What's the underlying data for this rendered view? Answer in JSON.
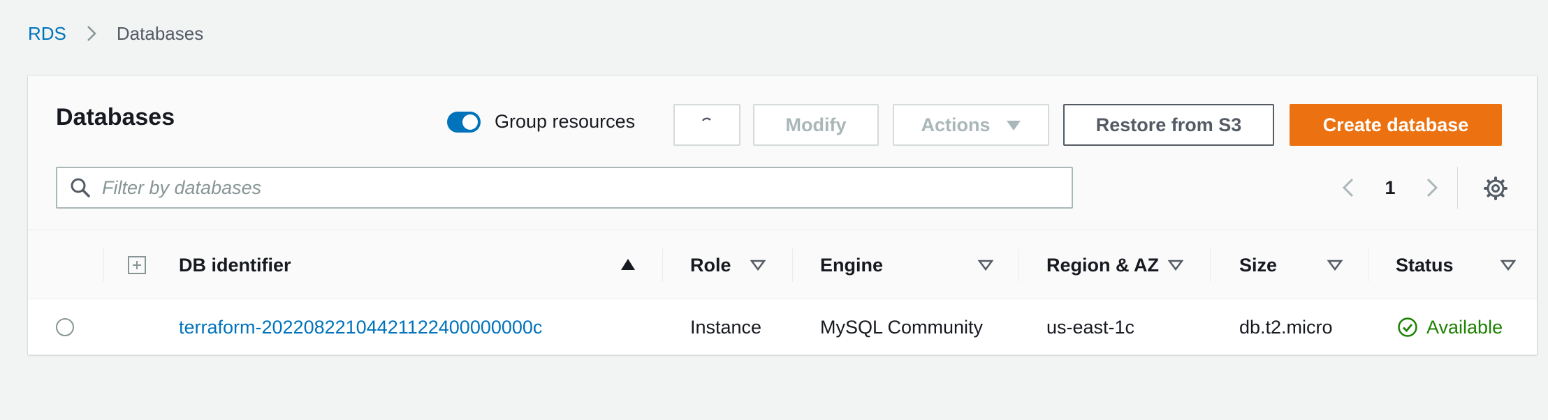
{
  "breadcrumb": {
    "root": "RDS",
    "current": "Databases"
  },
  "panel": {
    "title": "Databases",
    "group_resources_label": "Group resources",
    "group_resources_on": true
  },
  "toolbar": {
    "modify_label": "Modify",
    "actions_label": "Actions",
    "restore_label": "Restore from S3",
    "create_label": "Create database"
  },
  "search": {
    "placeholder": "Filter by databases",
    "value": ""
  },
  "pagination": {
    "current_page": "1"
  },
  "table": {
    "columns": [
      {
        "label": "DB identifier",
        "sort": "ascending"
      },
      {
        "label": "Role",
        "sort": "none"
      },
      {
        "label": "Engine",
        "sort": "none"
      },
      {
        "label": "Region & AZ",
        "sort": "none"
      },
      {
        "label": "Size",
        "sort": "none"
      },
      {
        "label": "Status",
        "sort": "none"
      }
    ],
    "rows": [
      {
        "db_identifier": "terraform-20220822104421122400000000c",
        "role": "Instance",
        "engine": "MySQL Community",
        "region_az": "us-east-1c",
        "size": "db.t2.micro",
        "status": "Available"
      }
    ]
  },
  "colors": {
    "link": "#0073bb",
    "primary_button": "#ec7211",
    "status_ok": "#1d8102",
    "toggle_on": "#0073bb"
  },
  "icons": {
    "breadcrumb_separator": "chevron-right-icon",
    "search": "search-icon",
    "refresh": "refresh-icon",
    "actions_dropdown": "caret-down-icon",
    "settings": "gear-icon",
    "expand_all": "expand-all-icon",
    "status": "check-circle-icon"
  }
}
